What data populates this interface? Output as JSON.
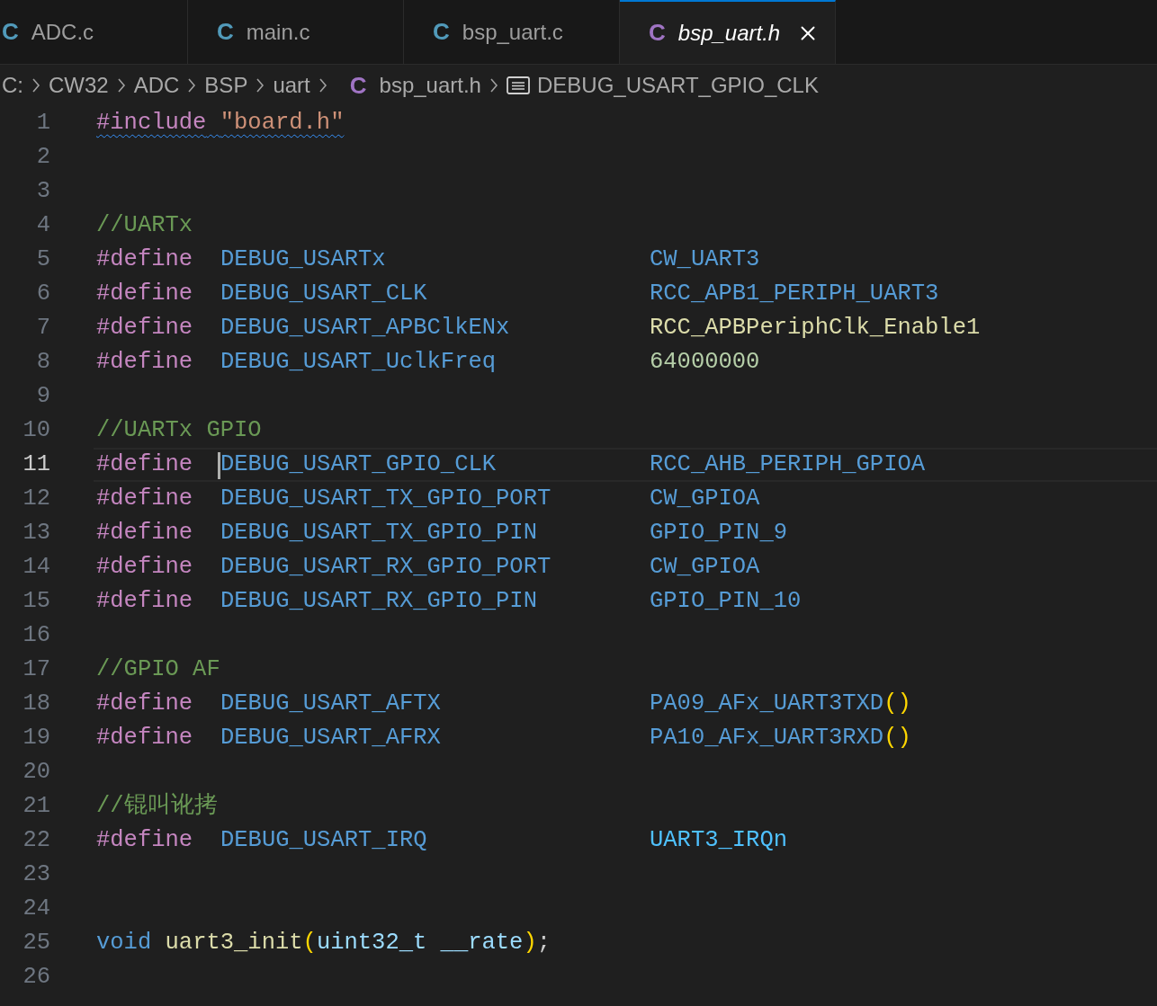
{
  "tabs": [
    {
      "icon": "C",
      "color": "#519aba",
      "label": "ADC.c",
      "selected": false,
      "preview": false
    },
    {
      "icon": "C",
      "color": "#519aba",
      "label": "main.c",
      "selected": false,
      "preview": false
    },
    {
      "icon": "C",
      "color": "#519aba",
      "label": "bsp_uart.c",
      "selected": false,
      "preview": false
    },
    {
      "icon": "C",
      "color": "#a074c4",
      "label": "bsp_uart.h",
      "selected": true,
      "preview": true
    }
  ],
  "breadcrumbs": [
    {
      "kind": "folder",
      "label": "C:"
    },
    {
      "kind": "folder",
      "label": "CW32"
    },
    {
      "kind": "folder",
      "label": "ADC"
    },
    {
      "kind": "folder",
      "label": "BSP"
    },
    {
      "kind": "folder",
      "label": "uart"
    },
    {
      "kind": "file",
      "icon": "C",
      "color": "#a074c4",
      "label": "bsp_uart.h"
    },
    {
      "kind": "symbol",
      "label": "DEBUG_USART_GPIO_CLK"
    }
  ],
  "lines": [
    {
      "number": "1",
      "current": false,
      "kind": "include",
      "directive": "#include",
      "path": "\"board.h\"",
      "warning": true
    },
    {
      "number": "2",
      "current": false,
      "kind": "blank"
    },
    {
      "number": "3",
      "current": false,
      "kind": "blank"
    },
    {
      "number": "4",
      "current": false,
      "kind": "comment",
      "text": "//UARTx"
    },
    {
      "number": "5",
      "current": false,
      "kind": "define",
      "directive": "#define",
      "name": "DEBUG_USARTx",
      "value": {
        "kind": "macro",
        "text": "CW_UART3"
      }
    },
    {
      "number": "6",
      "current": false,
      "kind": "define",
      "directive": "#define",
      "name": "DEBUG_USART_CLK",
      "value": {
        "kind": "macro",
        "text": "RCC_APB1_PERIPH_UART3"
      }
    },
    {
      "number": "7",
      "current": false,
      "kind": "define",
      "directive": "#define",
      "name": "DEBUG_USART_APBClkENx",
      "value": {
        "kind": "function",
        "text": "RCC_APBPeriphClk_Enable1"
      }
    },
    {
      "number": "8",
      "current": false,
      "kind": "define",
      "directive": "#define",
      "name": "DEBUG_USART_UclkFreq",
      "value": {
        "kind": "number",
        "text": "64000000"
      }
    },
    {
      "number": "9",
      "current": false,
      "kind": "blank"
    },
    {
      "number": "10",
      "current": false,
      "kind": "comment",
      "text": "//UARTx GPIO"
    },
    {
      "number": "11",
      "current": true,
      "kind": "define",
      "directive": "#define",
      "name": "DEBUG_USART_GPIO_CLK",
      "value": {
        "kind": "macro",
        "text": "RCC_AHB_PERIPH_GPIOA"
      }
    },
    {
      "number": "12",
      "current": false,
      "kind": "define",
      "directive": "#define",
      "name": "DEBUG_USART_TX_GPIO_PORT",
      "value": {
        "kind": "macro",
        "text": "CW_GPIOA"
      }
    },
    {
      "number": "13",
      "current": false,
      "kind": "define",
      "directive": "#define",
      "name": "DEBUG_USART_TX_GPIO_PIN",
      "value": {
        "kind": "macro",
        "text": "GPIO_PIN_9"
      }
    },
    {
      "number": "14",
      "current": false,
      "kind": "define",
      "directive": "#define",
      "name": "DEBUG_USART_RX_GPIO_PORT",
      "value": {
        "kind": "macro",
        "text": "CW_GPIOA"
      }
    },
    {
      "number": "15",
      "current": false,
      "kind": "define",
      "directive": "#define",
      "name": "DEBUG_USART_RX_GPIO_PIN",
      "value": {
        "kind": "macro",
        "text": "GPIO_PIN_10"
      }
    },
    {
      "number": "16",
      "current": false,
      "kind": "blank"
    },
    {
      "number": "17",
      "current": false,
      "kind": "comment",
      "text": "//GPIO AF"
    },
    {
      "number": "18",
      "current": false,
      "kind": "define",
      "directive": "#define",
      "name": "DEBUG_USART_AFTX",
      "value": {
        "kind": "macro",
        "text": "PA09_AFx_UART3TXD",
        "call": "()"
      }
    },
    {
      "number": "19",
      "current": false,
      "kind": "define",
      "directive": "#define",
      "name": "DEBUG_USART_AFRX",
      "value": {
        "kind": "macro",
        "text": "PA10_AFx_UART3RXD",
        "call": "()"
      }
    },
    {
      "number": "20",
      "current": false,
      "kind": "blank"
    },
    {
      "number": "21",
      "current": false,
      "kind": "comment",
      "text": "//锟叫讹拷"
    },
    {
      "number": "22",
      "current": false,
      "kind": "define",
      "directive": "#define",
      "name": "DEBUG_USART_IRQ",
      "value": {
        "kind": "enum",
        "text": "UART3_IRQn"
      }
    },
    {
      "number": "23",
      "current": false,
      "kind": "blank"
    },
    {
      "number": "24",
      "current": false,
      "kind": "blank"
    },
    {
      "number": "25",
      "current": false,
      "kind": "declaration",
      "type": "void",
      "func": "uart3_init",
      "open": "(",
      "param_type": "uint32_t",
      "param": "__rate",
      "close": ")",
      "end": ";"
    },
    {
      "number": "26",
      "current": false,
      "kind": "blank"
    }
  ]
}
